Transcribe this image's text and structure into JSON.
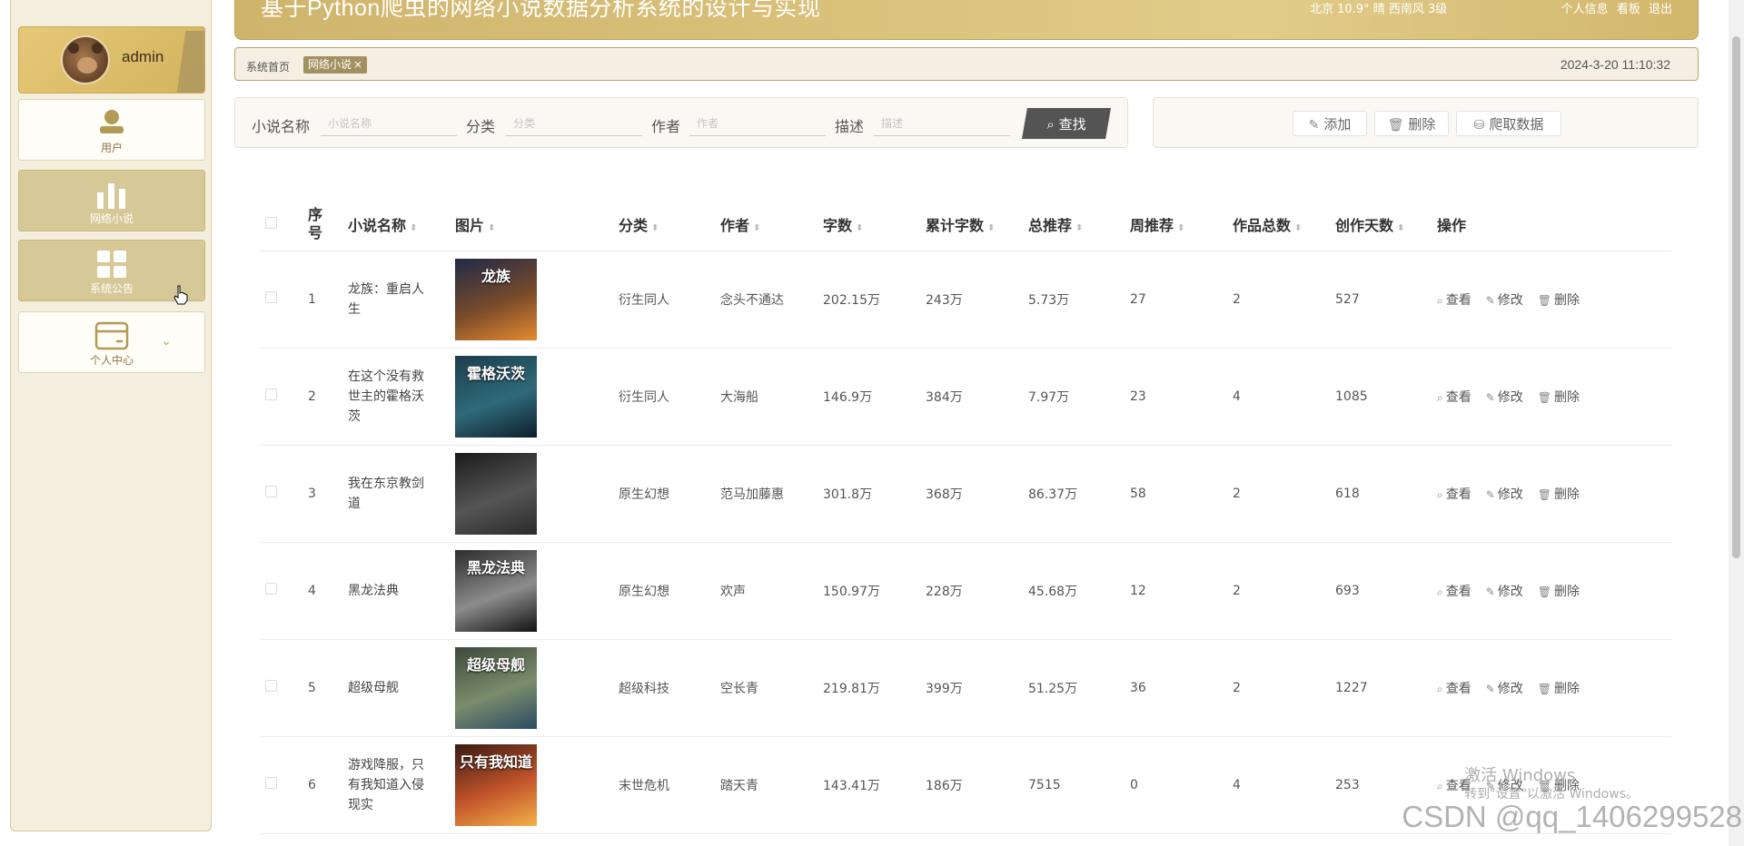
{
  "sidebar": {
    "username": "admin",
    "items": [
      {
        "label": "用户",
        "icon": "user-icon"
      },
      {
        "label": "网络小说",
        "icon": "bar-chart-icon"
      },
      {
        "label": "系统公告",
        "icon": "grid-icon"
      },
      {
        "label": "个人中心",
        "icon": "card-icon"
      }
    ]
  },
  "header": {
    "title": "基于Python爬虫的网络小说数据分析系统的设计与实现",
    "weather": "北京  10.9°  晴  西南风  3级",
    "links": [
      "个人信息",
      "看板",
      "退出"
    ]
  },
  "breadcrumb": {
    "home": "系统首页",
    "tag": "网络小说",
    "datetime": "2024-3-20 11:10:32"
  },
  "search": {
    "fields": [
      {
        "label": "小说名称",
        "placeholder": "小说名称"
      },
      {
        "label": "分类",
        "placeholder": "分类"
      },
      {
        "label": "作者",
        "placeholder": "作者"
      },
      {
        "label": "描述",
        "placeholder": "描述"
      }
    ],
    "button": "查找"
  },
  "actions": {
    "add": "添加",
    "delete": "删除",
    "crawl": "爬取数据"
  },
  "table": {
    "headers": [
      "序号",
      "小说名称",
      "图片",
      "分类",
      "作者",
      "字数",
      "累计字数",
      "总推荐",
      "周推荐",
      "作品总数",
      "创作天数",
      "操作"
    ],
    "ops": [
      "查看",
      "修改",
      "删除"
    ],
    "rows": [
      {
        "idx": "1",
        "name": "龙族：重启人生",
        "cover_text": "龙族",
        "cover": [
          "#1f2a47",
          "#7a4b2a",
          "#e58a2f"
        ],
        "category": "衍生同人",
        "author": "念头不通达",
        "words": "202.15万",
        "total_words": "243万",
        "total_rec": "5.73万",
        "week_rec": "27",
        "works": "2",
        "days": "527"
      },
      {
        "idx": "2",
        "name": "在这个没有救世主的霍格沃茨",
        "cover_text": "霍格沃茨",
        "cover": [
          "#1c3d4a",
          "#2f6a7a",
          "#0e1e2a"
        ],
        "category": "衍生同人",
        "author": "大海船",
        "words": "146.9万",
        "total_words": "384万",
        "total_rec": "7.97万",
        "week_rec": "23",
        "works": "4",
        "days": "1085"
      },
      {
        "idx": "3",
        "name": "我在东京教剑道",
        "cover_text": "",
        "cover": [
          "#1b1b1b",
          "#555555",
          "#2a2a2a"
        ],
        "category": "原生幻想",
        "author": "范马加藤惠",
        "words": "301.8万",
        "total_words": "368万",
        "total_rec": "86.37万",
        "week_rec": "58",
        "works": "2",
        "days": "618"
      },
      {
        "idx": "4",
        "name": "黑龙法典",
        "cover_text": "黑龙法典",
        "cover": [
          "#2c2c2c",
          "#8c8c8c",
          "#111111"
        ],
        "category": "原生幻想",
        "author": "欢声",
        "words": "150.97万",
        "total_words": "228万",
        "total_rec": "45.68万",
        "week_rec": "12",
        "works": "2",
        "days": "693"
      },
      {
        "idx": "5",
        "name": "超级母舰",
        "cover_text": "超级母舰",
        "cover": [
          "#3d4a3a",
          "#7b8c6c",
          "#2a4b63"
        ],
        "category": "超级科技",
        "author": "空长青",
        "words": "219.81万",
        "total_words": "399万",
        "total_rec": "51.25万",
        "week_rec": "36",
        "works": "2",
        "days": "1227"
      },
      {
        "idx": "6",
        "name": "游戏降服，只有我知道入侵现实",
        "cover_text": "只有我知道",
        "cover": [
          "#3a1a14",
          "#c2542a",
          "#f2b14a"
        ],
        "category": "末世危机",
        "author": "踏天青",
        "words": "143.41万",
        "total_words": "186万",
        "total_rec": "7515",
        "week_rec": "0",
        "works": "4",
        "days": "253"
      }
    ]
  },
  "watermark": {
    "line1": "激活 Windows",
    "line2": "转到\"设置\"以激活 Windows。",
    "csdn": "CSDN @qq_1406299528"
  }
}
